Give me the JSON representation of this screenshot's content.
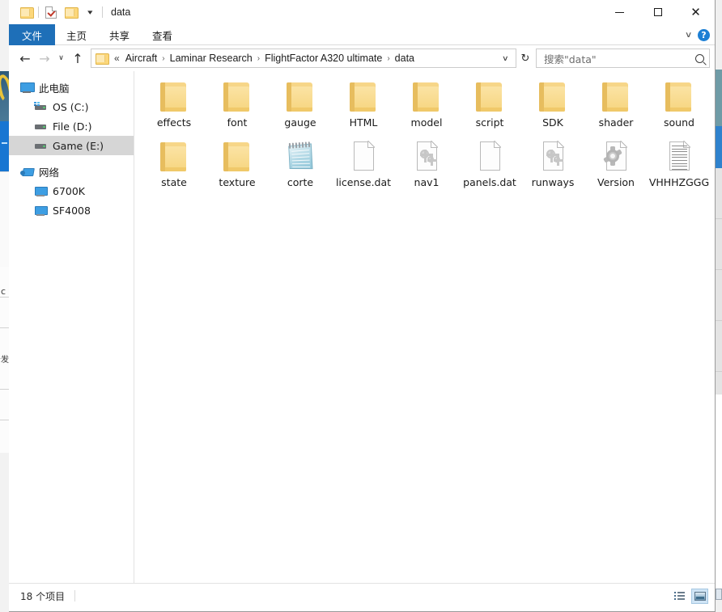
{
  "window": {
    "title": "data",
    "quick_access": [
      {
        "name": "folder-icon",
        "label": ""
      },
      {
        "name": "properties-icon",
        "label": ""
      },
      {
        "name": "new-folder-icon",
        "label": ""
      },
      {
        "name": "chevron-down-icon",
        "label": "▾"
      }
    ],
    "controls": {
      "minimize": "—",
      "maximize": "□",
      "close": "✕"
    }
  },
  "ribbon": {
    "tabs": [
      {
        "label": "文件",
        "selected": true
      },
      {
        "label": "主页",
        "selected": false
      },
      {
        "label": "共享",
        "selected": false
      },
      {
        "label": "查看",
        "selected": false
      }
    ],
    "collapse_chevron": "∨",
    "help_label": "?"
  },
  "address": {
    "back": "←",
    "forward": "→",
    "recent": "∨",
    "up": "↑",
    "double_chevron": "«",
    "separator": "›",
    "crumbs": [
      "Aircraft",
      "Laminar Research",
      "FlightFactor A320 ultimate",
      "data"
    ],
    "dropdown_chevron": "∨",
    "refresh": "↻"
  },
  "search": {
    "placeholder": "搜索\"data\"",
    "icon": "search-icon"
  },
  "sidebar": {
    "groups": [
      {
        "root": {
          "label": "此电脑",
          "icon": "this-pc-icon"
        },
        "items": [
          {
            "label": "OS (C:)",
            "icon": "drive-icon",
            "selected": false
          },
          {
            "label": "File (D:)",
            "icon": "drive-icon",
            "selected": false
          },
          {
            "label": "Game (E:)",
            "icon": "drive-icon",
            "selected": true
          }
        ]
      },
      {
        "root": {
          "label": "网络",
          "icon": "network-icon"
        },
        "items": [
          {
            "label": "6700K",
            "icon": "computer-icon",
            "selected": false
          },
          {
            "label": "SF4008",
            "icon": "computer-icon",
            "selected": false
          }
        ]
      }
    ]
  },
  "files": [
    {
      "name": "effects",
      "type": "folder"
    },
    {
      "name": "font",
      "type": "folder"
    },
    {
      "name": "gauge",
      "type": "folder"
    },
    {
      "name": "HTML",
      "type": "folder"
    },
    {
      "name": "model",
      "type": "folder"
    },
    {
      "name": "script",
      "type": "folder"
    },
    {
      "name": "SDK",
      "type": "folder"
    },
    {
      "name": "shader",
      "type": "folder"
    },
    {
      "name": "sound",
      "type": "folder"
    },
    {
      "name": "state",
      "type": "folder"
    },
    {
      "name": "texture",
      "type": "folder"
    },
    {
      "name": "corte",
      "type": "notepad"
    },
    {
      "name": "license.dat",
      "type": "blank-doc"
    },
    {
      "name": "nav1",
      "type": "gear-doc"
    },
    {
      "name": "panels.dat",
      "type": "blank-doc"
    },
    {
      "name": "runways",
      "type": "gear-doc"
    },
    {
      "name": "Version",
      "type": "big-gear-doc"
    },
    {
      "name": "VHHHZGGG",
      "type": "text-doc"
    }
  ],
  "status": {
    "item_count": "18 个项目",
    "views": [
      {
        "name": "details-view-button",
        "active": false
      },
      {
        "name": "large-icons-view-button",
        "active": true
      }
    ]
  }
}
